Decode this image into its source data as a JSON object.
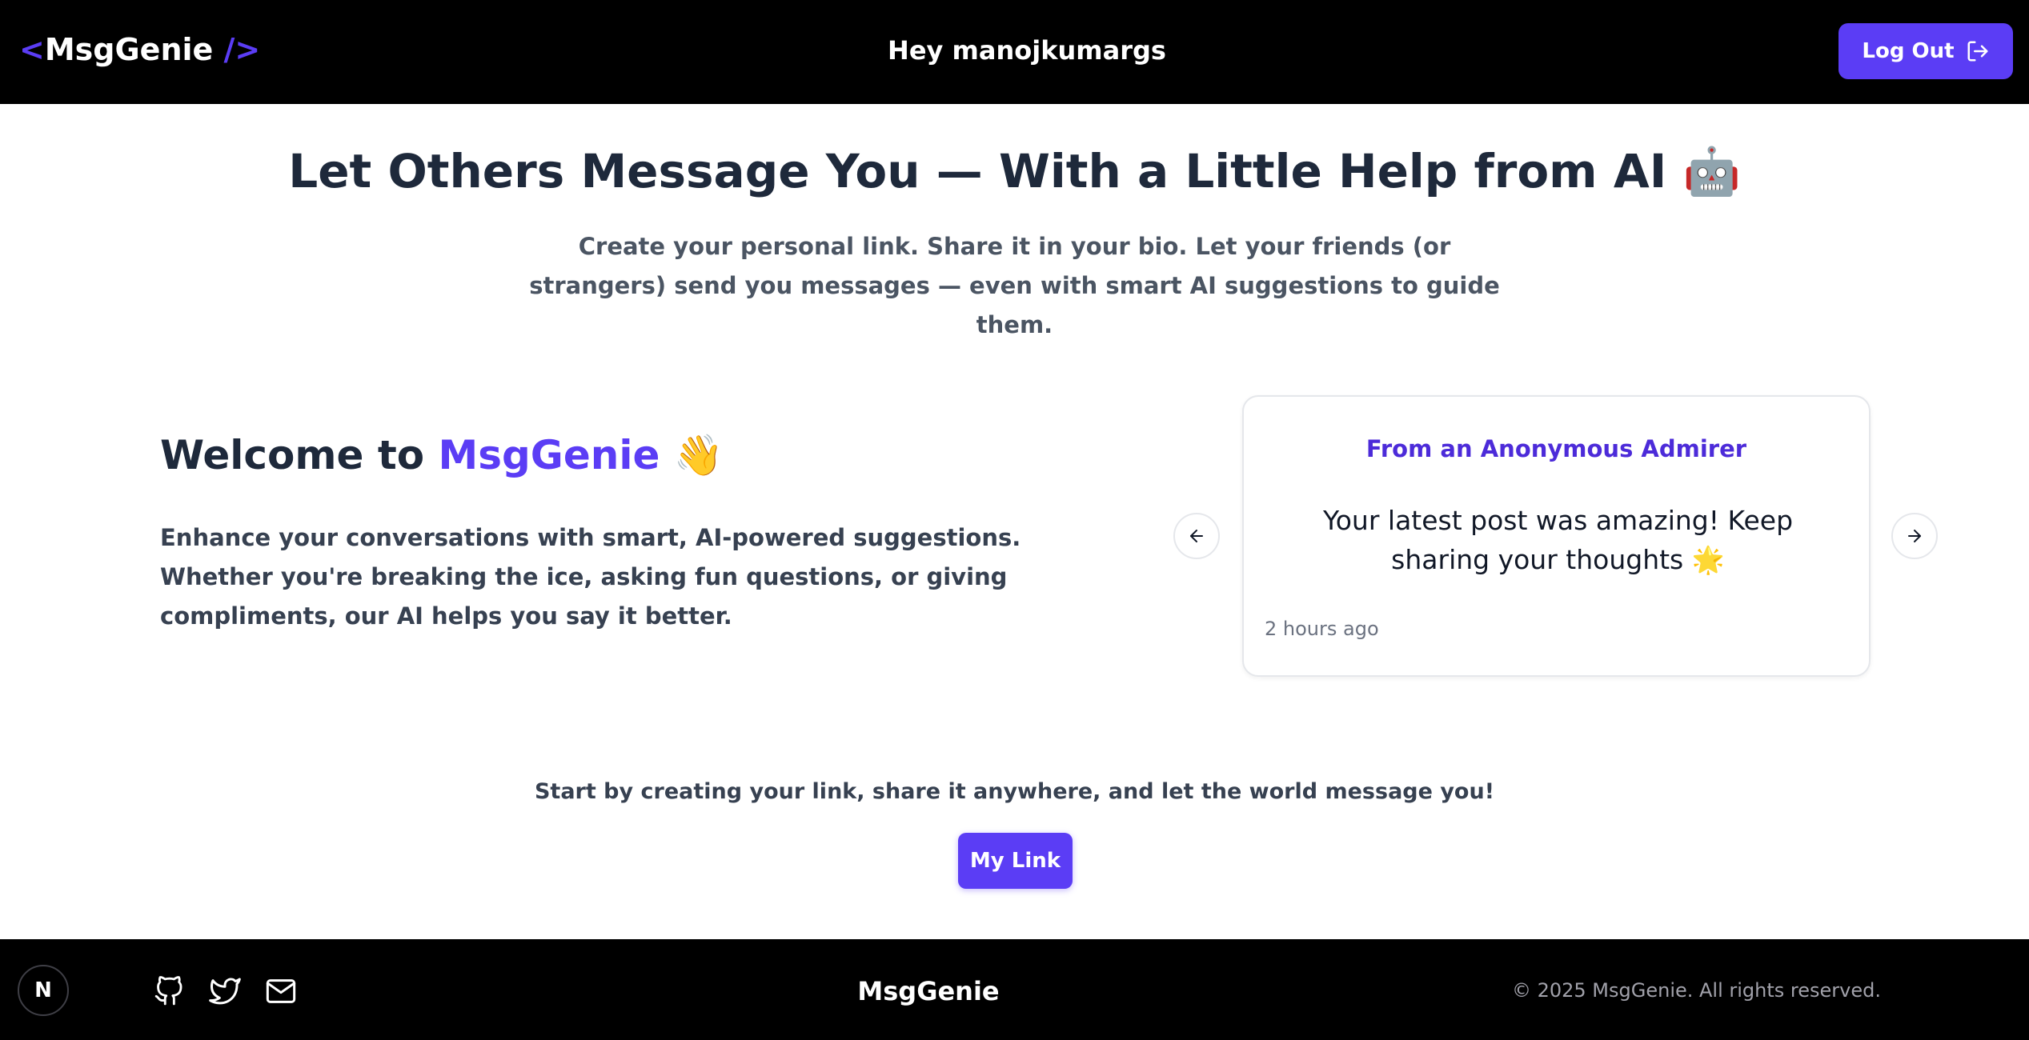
{
  "header": {
    "logo": {
      "open": "<",
      "name": "MsgGenie",
      "close": " />"
    },
    "greeting": "Hey  manojkumargs",
    "logout_label": "Log Out",
    "logout_icon": "logout-icon"
  },
  "hero": {
    "title": "Let Others Message You — With a Little Help from AI",
    "title_emoji": "🤖",
    "subtitle": "Create your personal link. Share it in your bio. Let your friends (or strangers) send you messages — even with smart AI suggestions to guide them."
  },
  "welcome": {
    "title_prefix": "Welcome to ",
    "title_brand": "MsgGenie",
    "title_emoji": "👋",
    "body": "Enhance your conversations with smart, AI-powered suggestions. Whether you're breaking the ice, asking fun questions, or giving compliments, our AI helps you say it better."
  },
  "carousel": {
    "card_title": "From an Anonymous Admirer",
    "message": "Your latest post was amazing! Keep sharing your thoughts 🌟",
    "time": "2 hours ago",
    "prev_icon": "arrow-left-icon",
    "next_icon": "arrow-right-icon"
  },
  "cta": {
    "text": "Start by creating your link, share it anywhere, and let the world message you!",
    "button_label": "My Link"
  },
  "footer": {
    "badge": "N",
    "brand": "MsgGenie",
    "copyright": "© 2025 MsgGenie. All rights reserved.",
    "social_icons": [
      "github-icon",
      "twitter-icon",
      "mail-icon"
    ]
  },
  "colors": {
    "accent": "#5b3df5",
    "header_bg": "#000000",
    "footer_bg": "#000000",
    "heading": "#1e293b",
    "card_title": "#4c2bd9"
  }
}
